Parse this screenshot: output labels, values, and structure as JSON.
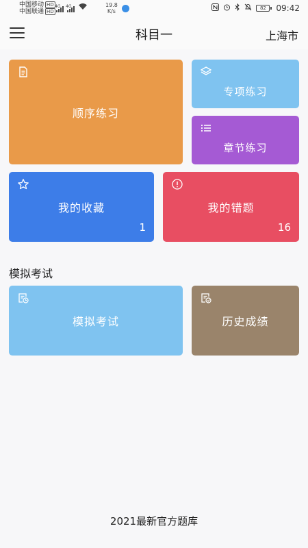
{
  "status_bar": {
    "carrier1": "中国移动",
    "carrier2": "中国联通",
    "hd": "HD",
    "net1": "4G",
    "net2": "4G",
    "speed_value": "19.8",
    "speed_unit": "K/s",
    "battery": "82",
    "time": "09:42"
  },
  "header": {
    "title": "科目一",
    "city": "上海市",
    "menu_icon": "hamburger-menu-icon"
  },
  "tiles": {
    "sequential": {
      "label": "顺序练习",
      "icon": "document-icon",
      "color": "#e99a49"
    },
    "special": {
      "label": "专项练习",
      "icon": "layers-icon",
      "color": "#7fc3f0"
    },
    "chapter": {
      "label": "章节练习",
      "icon": "list-icon",
      "color": "#a55ad4"
    },
    "favorites": {
      "label": "我的收藏",
      "icon": "star-icon",
      "count": "1",
      "color": "#3d7de8"
    },
    "mistakes": {
      "label": "我的错题",
      "icon": "alert-circle-icon",
      "count": "16",
      "color": "#e84e62"
    }
  },
  "exam_section": {
    "title": "模拟考试",
    "mock": {
      "label": "模拟考试",
      "icon": "exam-clock-icon",
      "color": "#7fc3f0"
    },
    "history": {
      "label": "历史成绩",
      "icon": "history-report-icon",
      "color": "#9a846b"
    }
  },
  "footer": {
    "text": "2021最新官方题库"
  }
}
